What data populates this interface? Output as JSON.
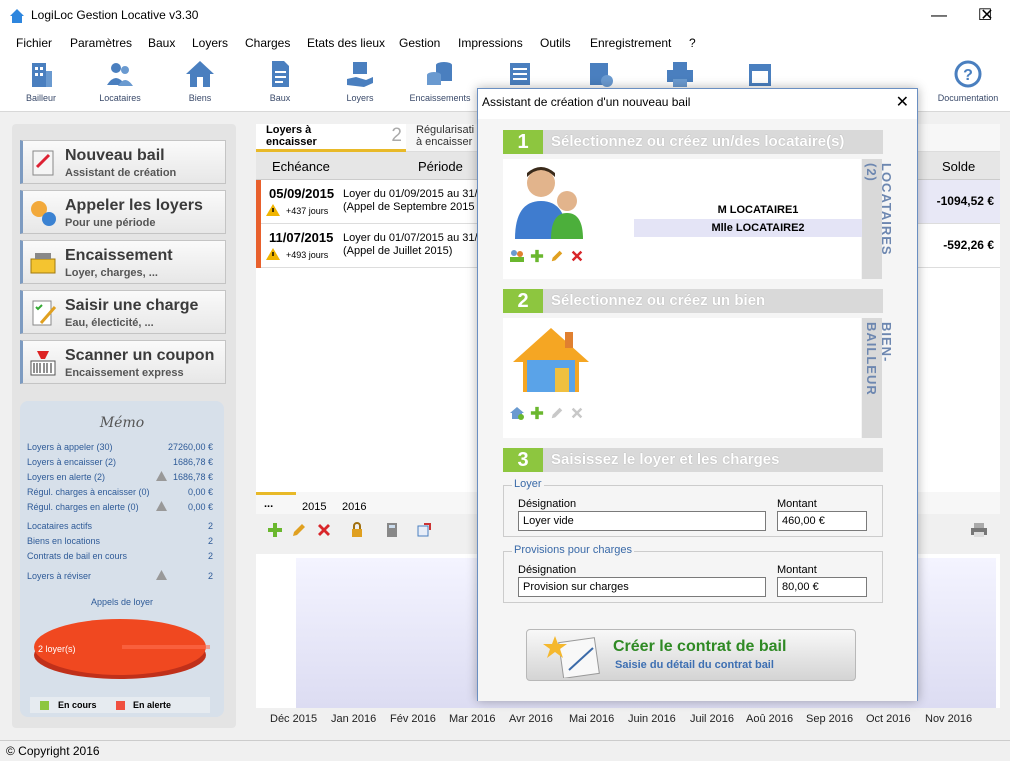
{
  "window": {
    "title": "LogiLoc Gestion Locative v3.30"
  },
  "menu": [
    "Fichier",
    "Paramètres",
    "Baux",
    "Loyers",
    "Charges",
    "Etats des lieux",
    "Gestion",
    "Impressions",
    "Outils",
    "Enregistrement",
    "?"
  ],
  "toolbar": [
    {
      "label": "Bailleur",
      "icon": "building-icon"
    },
    {
      "label": "Locataires",
      "icon": "users-icon"
    },
    {
      "label": "Biens",
      "icon": "house-icon"
    },
    {
      "label": "Baux",
      "icon": "document-icon"
    },
    {
      "label": "Loyers",
      "icon": "hand-money-icon"
    },
    {
      "label": "Encaissements",
      "icon": "coins-icon"
    },
    {
      "label": "Documentation",
      "icon": "help-icon"
    }
  ],
  "actions": [
    {
      "title": "Nouveau bail",
      "subtitle": "Assistant de création"
    },
    {
      "title": "Appeler les loyers",
      "subtitle": "Pour une période"
    },
    {
      "title": "Encaissement",
      "subtitle": "Loyer, charges, ..."
    },
    {
      "title": "Saisir une charge",
      "subtitle": "Eau, électicité, ..."
    },
    {
      "title": "Scanner un coupon",
      "subtitle": "Encaissement express"
    }
  ],
  "memo": {
    "title": "Mémo",
    "rows": [
      {
        "label": "Loyers à appeler (30)",
        "value": "27260,00 €"
      },
      {
        "label": "Loyers à encaisser (2)",
        "value": "1686,78 €"
      },
      {
        "label": "Loyers en alerte (2)",
        "value": "1686,78 €",
        "warn": true
      },
      {
        "label": "Régul. charges à encaisser (0)",
        "value": "0,00 €"
      },
      {
        "label": "Régul. charges en alerte (0)",
        "value": "0,00 €",
        "warn": true
      },
      {
        "label": "Locataires actifs",
        "value": "2"
      },
      {
        "label": "Biens en locations",
        "value": "2"
      },
      {
        "label": "Contrats de bail en cours",
        "value": "2"
      },
      {
        "label": "Loyers à réviser",
        "value": "2",
        "warn": true
      }
    ],
    "pie_title": "Appels de loyer",
    "pie_label": "2 loyer(s)",
    "legend": [
      {
        "label": "En cours",
        "color": "#8dc63f"
      },
      {
        "label": "En alerte",
        "color": "#f05040"
      }
    ]
  },
  "tabs": {
    "tab1_line1": "Loyers à",
    "tab1_line2": "encaisser",
    "tab1_num": "2",
    "tab2_line1": "Régularisati",
    "tab2_line2": "à encaisser"
  },
  "grid": {
    "col_echeance": "Echéance",
    "col_periode": "Période",
    "col_solde": "Solde",
    "rows": [
      {
        "date": "05/09/2015",
        "days": "+437 jours",
        "line1": "Loyer du 01/09/2015 au 31/",
        "line2": "(Appel de Septembre 2015",
        "solde": "-1094,52 €"
      },
      {
        "date": "11/07/2015",
        "days": "+493 jours",
        "line1": "Loyer du 01/07/2015 au 31/",
        "line2": "(Appel de Juillet 2015)",
        "solde": "-592,26 €"
      }
    ]
  },
  "years": [
    "...",
    "2015",
    "2016"
  ],
  "months": [
    "Déc 2015",
    "Jan 2016",
    "Fév 2016",
    "Mar 2016",
    "Avr 2016",
    "Mai 2016",
    "Juin 2016",
    "Juil 2016",
    "Aoû 2016",
    "Sep 2016",
    "Oct 2016",
    "Nov 2016"
  ],
  "status": "© Copyright 2016",
  "dialog": {
    "title": "Assistant de création d'un nouveau bail",
    "step1": {
      "num": "1",
      "text": "Sélectionnez ou créez un/des locataire(s)",
      "side": "LOCATAIRES (2)"
    },
    "tenants": [
      "M LOCATAIRE1",
      "Mlle LOCATAIRE2"
    ],
    "step2": {
      "num": "2",
      "text": "Sélectionnez ou créez un bien",
      "side": "BIEN-BAILLEUR"
    },
    "step3": {
      "num": "3",
      "text": "Saisissez le loyer et les charges"
    },
    "loyer": {
      "legend": "Loyer",
      "designation_label": "Désignation",
      "montant_label": "Montant",
      "designation": "Loyer vide",
      "montant": "460,00 €"
    },
    "provisions": {
      "legend": "Provisions pour charges",
      "designation_label": "Désignation",
      "montant_label": "Montant",
      "designation": "Provision sur charges",
      "montant": "80,00 €"
    },
    "create": {
      "title": "Créer le contrat de bail",
      "subtitle": "Saisie du détail du contrat bail"
    }
  }
}
